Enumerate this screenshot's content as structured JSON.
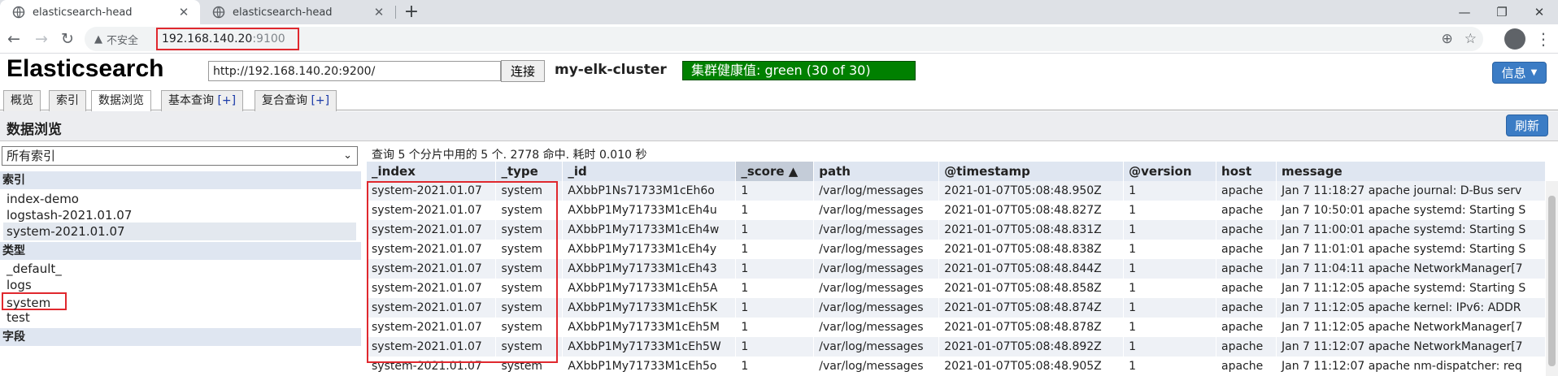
{
  "browser": {
    "tabs": [
      {
        "title": "elasticsearch-head",
        "close": "✕"
      },
      {
        "title": "elasticsearch-head",
        "close": "✕"
      }
    ],
    "new_tab": "+",
    "insecure_label": "不安全",
    "url_host": "192.168.140.20",
    "url_port": ":9100"
  },
  "app": {
    "title": "Elasticsearch",
    "connect_url": "http://192.168.140.20:9200/",
    "connect_button": "连接",
    "cluster_name": "my-elk-cluster",
    "health": "集群健康值: green (30 of 30)",
    "info_button": "信息",
    "health_color": "#008000",
    "accent_color": "#3b7cc5"
  },
  "nav_tabs": [
    {
      "label": "概览",
      "plus": ""
    },
    {
      "label": "索引",
      "plus": ""
    },
    {
      "label": "数据浏览",
      "plus": ""
    },
    {
      "label": "基本查询 ",
      "plus": "[+]"
    },
    {
      "label": "复合查询 ",
      "plus": "[+]"
    }
  ],
  "section": {
    "title": "数据浏览",
    "refresh": "刷新"
  },
  "sidebar": {
    "select_value": "所有索引",
    "index_heading": "索引",
    "indices": [
      "index-demo",
      "logstash-2021.01.07",
      "system-2021.01.07"
    ],
    "type_heading": "类型",
    "types": [
      "_default_",
      "logs",
      "system",
      "test"
    ],
    "field_heading": "字段"
  },
  "results": {
    "query_info": "查询 5 个分片中用的 5 个. 2778 命中. 耗时 0.010 秒",
    "columns": [
      "_index",
      "_type",
      "_id",
      "_score ▲",
      "path",
      "@timestamp",
      "@version",
      "host",
      "message"
    ],
    "rows": [
      [
        "system-2021.01.07",
        "system",
        "AXbbP1Ns71733M1cEh6o",
        "1",
        "/var/log/messages",
        "2021-01-07T05:08:48.950Z",
        "1",
        "apache",
        "Jan 7 11:18:27 apache journal: D-Bus serv"
      ],
      [
        "system-2021.01.07",
        "system",
        "AXbbP1My71733M1cEh4u",
        "1",
        "/var/log/messages",
        "2021-01-07T05:08:48.827Z",
        "1",
        "apache",
        "Jan 7 10:50:01 apache systemd: Starting S"
      ],
      [
        "system-2021.01.07",
        "system",
        "AXbbP1My71733M1cEh4w",
        "1",
        "/var/log/messages",
        "2021-01-07T05:08:48.831Z",
        "1",
        "apache",
        "Jan 7 11:00:01 apache systemd: Starting S"
      ],
      [
        "system-2021.01.07",
        "system",
        "AXbbP1My71733M1cEh4y",
        "1",
        "/var/log/messages",
        "2021-01-07T05:08:48.838Z",
        "1",
        "apache",
        "Jan 7 11:01:01 apache systemd: Starting S"
      ],
      [
        "system-2021.01.07",
        "system",
        "AXbbP1My71733M1cEh43",
        "1",
        "/var/log/messages",
        "2021-01-07T05:08:48.844Z",
        "1",
        "apache",
        "Jan 7 11:04:11 apache NetworkManager[7"
      ],
      [
        "system-2021.01.07",
        "system",
        "AXbbP1My71733M1cEh5A",
        "1",
        "/var/log/messages",
        "2021-01-07T05:08:48.858Z",
        "1",
        "apache",
        "Jan 7 11:12:05 apache systemd: Starting S"
      ],
      [
        "system-2021.01.07",
        "system",
        "AXbbP1My71733M1cEh5K",
        "1",
        "/var/log/messages",
        "2021-01-07T05:08:48.874Z",
        "1",
        "apache",
        "Jan 7 11:12:05 apache kernel: IPv6: ADDR"
      ],
      [
        "system-2021.01.07",
        "system",
        "AXbbP1My71733M1cEh5M",
        "1",
        "/var/log/messages",
        "2021-01-07T05:08:48.878Z",
        "1",
        "apache",
        "Jan 7 11:12:05 apache NetworkManager[7"
      ],
      [
        "system-2021.01.07",
        "system",
        "AXbbP1My71733M1cEh5W",
        "1",
        "/var/log/messages",
        "2021-01-07T05:08:48.892Z",
        "1",
        "apache",
        "Jan 7 11:12:07 apache NetworkManager[7"
      ],
      [
        "system-2021.01.07",
        "system",
        "AXbbP1My71733M1cEh5o",
        "1",
        "/var/log/messages",
        "2021-01-07T05:08:48.905Z",
        "1",
        "apache",
        "Jan 7 11:12:07 apache nm-dispatcher: req"
      ]
    ]
  }
}
